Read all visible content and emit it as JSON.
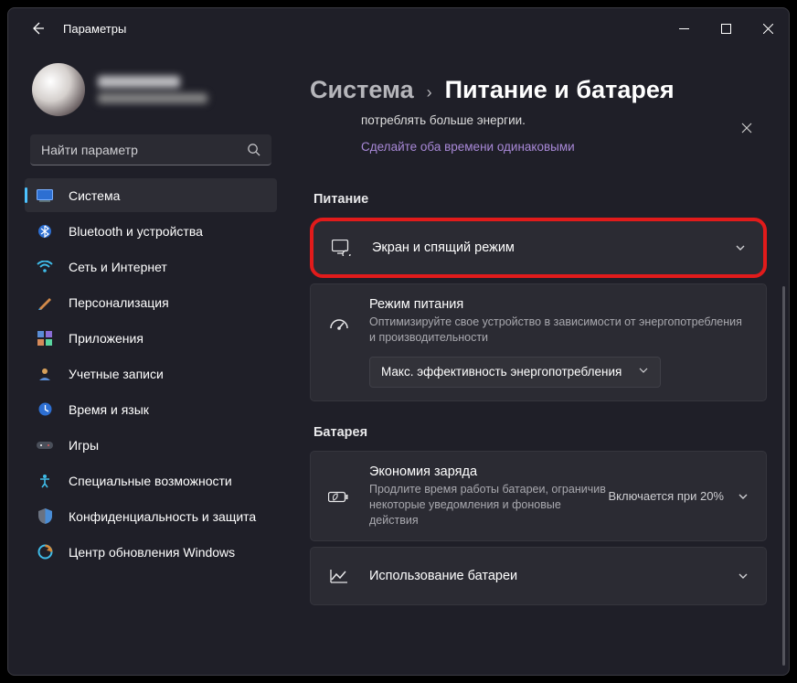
{
  "titlebar": {
    "title": "Параметры"
  },
  "profile": {
    "name_blurred": true,
    "email_blurred": true
  },
  "search": {
    "placeholder": "Найти параметр"
  },
  "sidebar": {
    "items": [
      {
        "id": "system",
        "label": "Система",
        "active": true
      },
      {
        "id": "bluetooth",
        "label": "Bluetooth и устройства"
      },
      {
        "id": "network",
        "label": "Сеть и Интернет"
      },
      {
        "id": "personalization",
        "label": "Персонализация"
      },
      {
        "id": "apps",
        "label": "Приложения"
      },
      {
        "id": "accounts",
        "label": "Учетные записи"
      },
      {
        "id": "time",
        "label": "Время и язык"
      },
      {
        "id": "gaming",
        "label": "Игры"
      },
      {
        "id": "accessibility",
        "label": "Специальные возможности"
      },
      {
        "id": "privacy",
        "label": "Конфиденциальность и защита"
      },
      {
        "id": "update",
        "label": "Центр обновления Windows"
      }
    ]
  },
  "breadcrumb": {
    "parent": "Система",
    "sep": "›",
    "current": "Питание и батарея"
  },
  "notice": {
    "text": "потреблять больше энергии.",
    "link": "Сделайте оба времени одинаковыми"
  },
  "sections": {
    "power": {
      "label": "Питание",
      "screen_sleep": {
        "title": "Экран и спящий режим"
      },
      "power_mode": {
        "title": "Режим питания",
        "sub": "Оптимизируйте свое устройство в зависимости от энергопотребления и производительности",
        "dropdown": "Макс. эффективность энергопотребления"
      }
    },
    "battery": {
      "label": "Батарея",
      "saver": {
        "title": "Экономия заряда",
        "sub": "Продлите время работы батареи, ограничив некоторые уведомления и фоновые действия",
        "right": "Включается при 20%"
      },
      "usage": {
        "title": "Использование батареи"
      }
    }
  }
}
